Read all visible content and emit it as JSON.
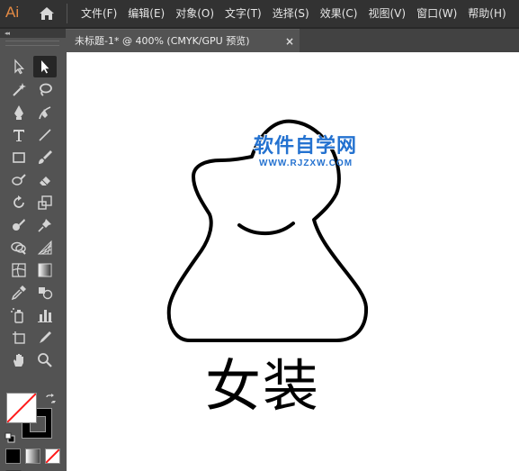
{
  "app": {
    "logo": "Ai"
  },
  "menu": [
    "文件(F)",
    "编辑(E)",
    "对象(O)",
    "文字(T)",
    "选择(S)",
    "效果(C)",
    "视图(V)",
    "窗口(W)",
    "帮助(H)"
  ],
  "tools_panel": {
    "collapse": "◂◂"
  },
  "document_tab": {
    "title": "未标题-1* @ 400% (CMYK/GPU 预览)",
    "close": "×"
  },
  "artwork": {
    "caption": "女装"
  },
  "watermark": {
    "title": "软件自学网",
    "url": "WWW.RJZXW.COM"
  },
  "colors": {
    "accent_logo": "#E38A44",
    "watermark": "#2472D0",
    "canvas": "#FFFFFF",
    "panel": "#535353",
    "menubar": "#323232"
  }
}
